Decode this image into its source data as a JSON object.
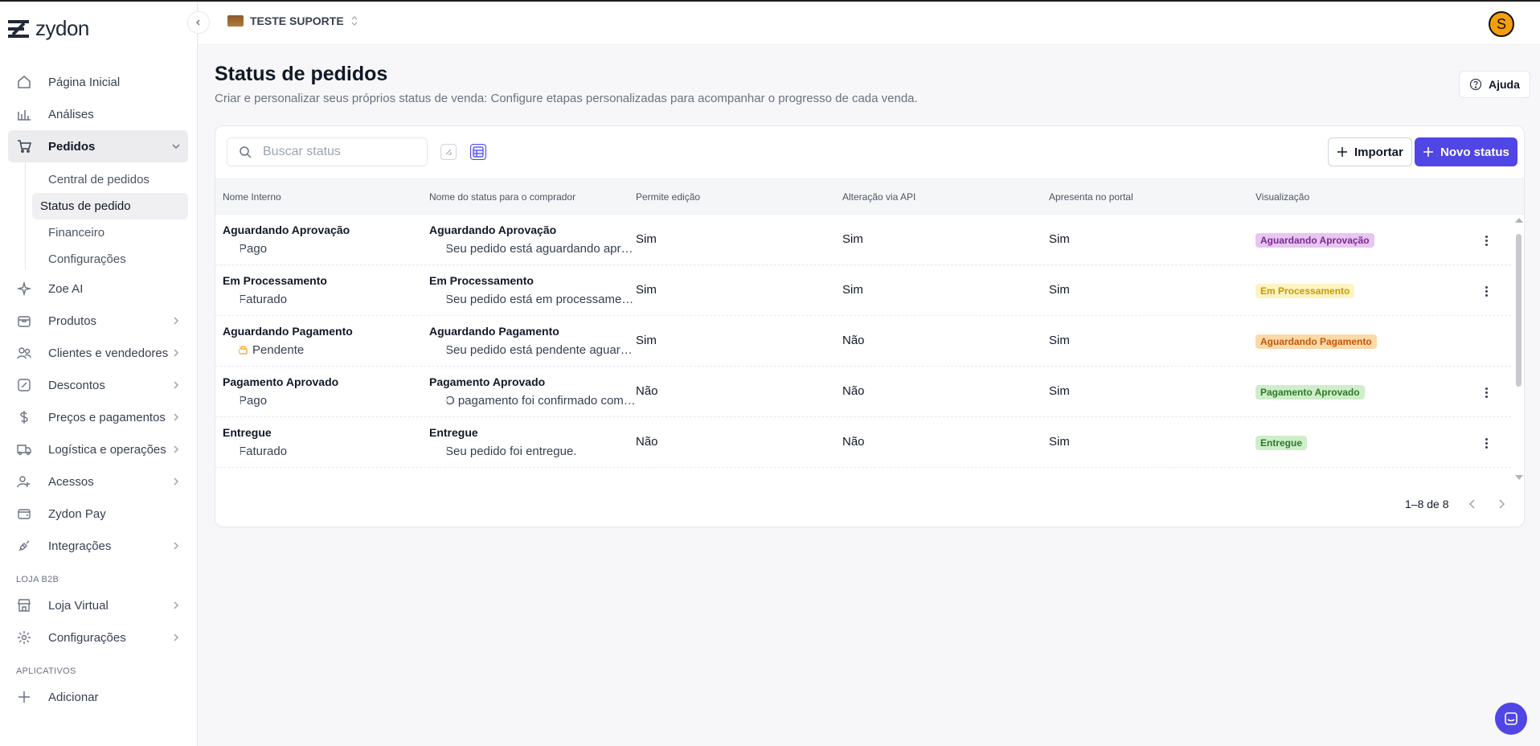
{
  "brand": {
    "name": "zydon"
  },
  "store": {
    "name": "TESTE SUPORTE"
  },
  "user": {
    "initial": "S"
  },
  "nav": {
    "items": [
      {
        "label": "Página Inicial"
      },
      {
        "label": "Análises"
      },
      {
        "label": "Pedidos"
      }
    ],
    "pedidos_sub": [
      {
        "label": "Central de pedidos"
      },
      {
        "label": "Status de pedido"
      },
      {
        "label": "Financeiro"
      },
      {
        "label": "Configurações"
      }
    ],
    "items2": [
      {
        "label": "Zoe AI"
      },
      {
        "label": "Produtos"
      },
      {
        "label": "Clientes e vendedores"
      },
      {
        "label": "Descontos"
      },
      {
        "label": "Preços e pagamentos"
      },
      {
        "label": "Logística e operações"
      },
      {
        "label": "Acessos"
      },
      {
        "label": "Zydon Pay"
      },
      {
        "label": "Integrações"
      }
    ],
    "section_b2b": "LOJA B2B",
    "b2b_items": [
      {
        "label": "Loja Virtual"
      },
      {
        "label": "Configurações"
      }
    ],
    "section_apps": "APLICATIVOS",
    "apps_add": "Adicionar"
  },
  "page": {
    "title": "Status de pedidos",
    "description": "Criar e personalizar seus próprios status de venda: Configure etapas personalizadas para acompanhar o progresso de cada venda.",
    "help_label": "Ajuda"
  },
  "toolbar": {
    "search_placeholder": "Buscar status",
    "import_label": "Importar",
    "new_label": "Novo status"
  },
  "table": {
    "headers": {
      "internal": "Nome Interno",
      "buyer": "Nome do status para o comprador",
      "edit": "Permite edição",
      "api": "Alteração via API",
      "portal": "Apresenta no portal",
      "view": "Visualização"
    },
    "rows": [
      {
        "internal": "Aguardando Aprovação",
        "group": "Pago",
        "buyer_name": "Aguardando Aprovação",
        "buyer_desc": "Seu pedido está aguardando aprovação.",
        "edit": "Sim",
        "api": "Sim",
        "portal": "Sim",
        "badge": "Aguardando Aprovação",
        "badge_bg": "#e7c6f0",
        "badge_fg": "#7e2a91"
      },
      {
        "internal": "Em Processamento",
        "group": "Faturado",
        "buyer_name": "Em Processamento",
        "buyer_desc": "Seu pedido está em processamento.",
        "edit": "Sim",
        "api": "Sim",
        "portal": "Sim",
        "badge": "Em Processamento",
        "badge_bg": "#fdf3c3",
        "badge_fg": "#c99a06"
      },
      {
        "internal": "Aguardando Pagamento",
        "group": "Pendente",
        "buyer_name": "Aguardando Pagamento",
        "buyer_desc": "Seu pedido está pendente aguardando pagamento.",
        "edit": "Sim",
        "api": "Não",
        "portal": "Sim",
        "badge": "Aguardando Pagamento",
        "badge_bg": "#fcd9a8",
        "badge_fg": "#c2580c"
      },
      {
        "internal": "Pagamento Aprovado",
        "group": "Pago",
        "buyer_name": "Pagamento Aprovado",
        "buyer_desc": "O pagamento foi confirmado com sucesso.",
        "edit": "Não",
        "api": "Não",
        "portal": "Sim",
        "badge": "Pagamento Aprovado",
        "badge_bg": "#cdeec9",
        "badge_fg": "#2f7a2a"
      },
      {
        "internal": "Entregue",
        "group": "Faturado",
        "buyer_name": "Entregue",
        "buyer_desc": "Seu pedido foi entregue.",
        "edit": "Não",
        "api": "Não",
        "portal": "Sim",
        "badge": "Entregue",
        "badge_bg": "#cdeec9",
        "badge_fg": "#2f7a2a"
      }
    ]
  },
  "pagination": {
    "label": "1–8 de 8"
  },
  "colors": {
    "accent": "#5046e5"
  }
}
